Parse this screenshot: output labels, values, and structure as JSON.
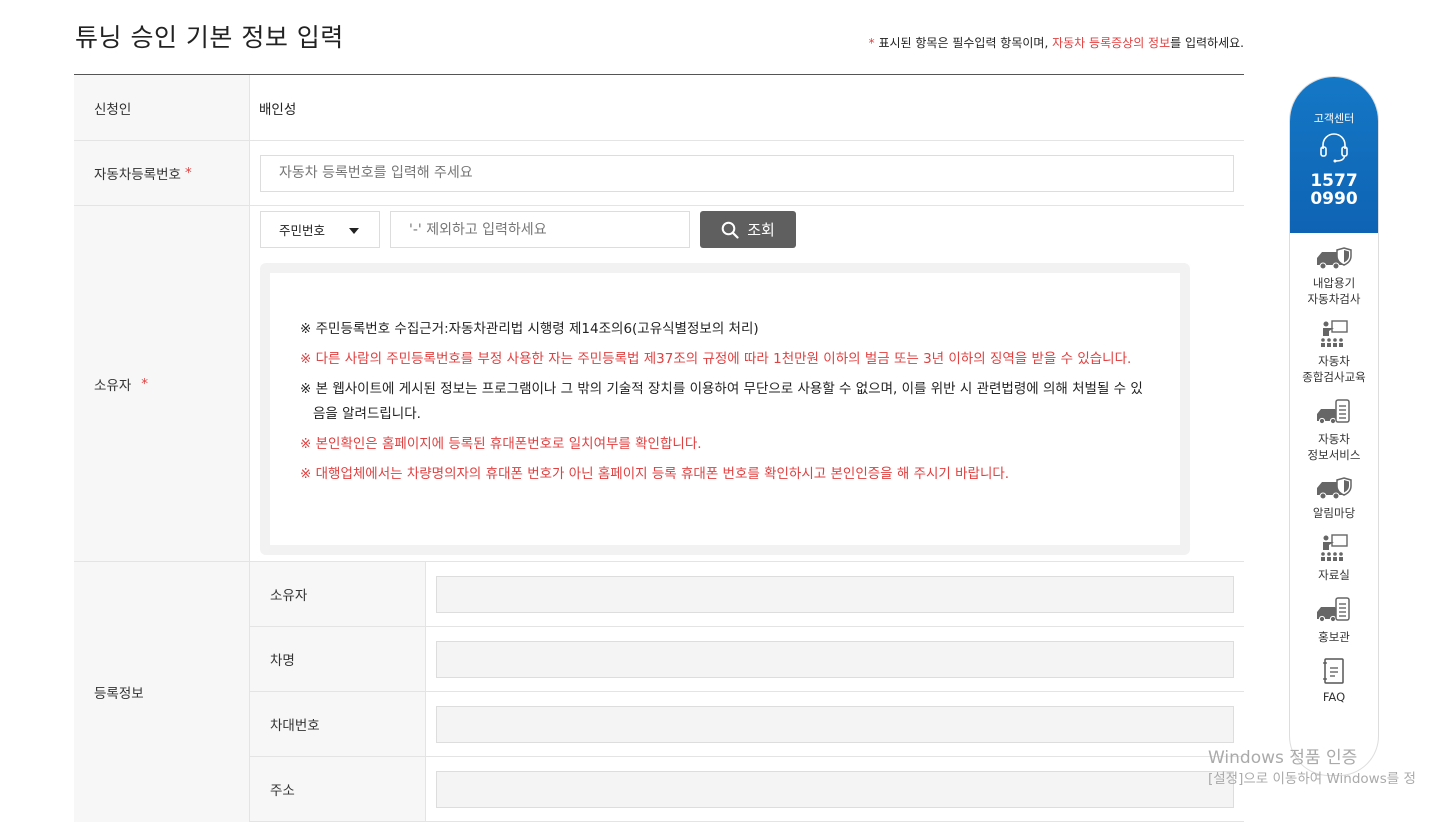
{
  "page": {
    "title": "튜닝 승인 기본 정보 입력",
    "required_note": {
      "star": "*",
      "text_before": " 표시된 항목은 필수입력 항목이며, ",
      "highlight": "자동차 등록증상의 정보",
      "text_after": "를 입력하세요."
    }
  },
  "form": {
    "applicant": {
      "label": "신청인",
      "value": "배인성"
    },
    "plate": {
      "label": "자동차등록번호",
      "star": "*",
      "placeholder": "자동차 등록번호를 입력해 주세요"
    },
    "owner": {
      "label": "소유자",
      "star": "*",
      "id_type": "주민번호",
      "id_placeholder": "'-' 제외하고 입력하세요",
      "search_label": "조회",
      "notices": [
        {
          "text": "※ 주민등록번호 수집근거:자동차관리법 시행령 제14조의6(고유식별정보의 처리)",
          "color": "black"
        },
        {
          "text": "※ 다른 사람의 주민등록번호를 부정 사용한 자는 주민등록법 제37조의 규정에 따라 1천만원 이하의 벌금 또는 3년 이하의 징역을 받을 수 있습니다.",
          "color": "red"
        },
        {
          "text": "※ 본 웹사이트에 게시된 정보는 프로그램이나 그 밖의 기술적 장치를 이용하여 무단으로 사용할 수 없으며, 이를 위반 시 관련법령에 의해 처벌될 수 있음을 알려드립니다.",
          "color": "black"
        },
        {
          "text": "※ 본인확인은 홈페이지에 등록된 휴대폰번호로 일치여부를 확인합니다.",
          "color": "red"
        },
        {
          "text": "※ 대행업체에서는 차량명의자의 휴대폰 번호가 아닌 홈페이지 등록 휴대폰 번호를 확인하시고 본인인증을 해 주시기 바랍니다.",
          "color": "red"
        }
      ]
    },
    "registration": {
      "label": "등록정보",
      "fields": [
        {
          "label": "소유자",
          "value": ""
        },
        {
          "label": "차명",
          "value": ""
        },
        {
          "label": "차대번호",
          "value": ""
        },
        {
          "label": "주소",
          "value": ""
        }
      ]
    }
  },
  "quick_menu": {
    "customer_center": {
      "title": "고객센터",
      "phone_line1": "1577",
      "phone_line2": "0990"
    },
    "items": [
      {
        "label_line1": "내압용기",
        "label_line2": "자동차검사",
        "icon": "car-shield-icon"
      },
      {
        "label_line1": "자동차",
        "label_line2": "종합검사교육",
        "icon": "lecture-icon"
      },
      {
        "label_line1": "자동차",
        "label_line2": "정보서비스",
        "icon": "car-checklist-icon"
      },
      {
        "label_line1": "알림마당",
        "label_line2": "",
        "icon": "car-shield-icon"
      },
      {
        "label_line1": "자료실",
        "label_line2": "",
        "icon": "lecture-icon"
      },
      {
        "label_line1": "홍보관",
        "label_line2": "",
        "icon": "car-checklist-icon"
      },
      {
        "label_line1": "FAQ",
        "label_line2": "",
        "icon": "document-icon"
      }
    ]
  },
  "watermark": {
    "line1": "Windows 정품 인증",
    "line2": "[설정]으로 이동하여 Windows를 정"
  },
  "colors": {
    "accent_blue": "#1470c0",
    "required_red": "#e04040",
    "button_gray": "#5f5f5f"
  }
}
